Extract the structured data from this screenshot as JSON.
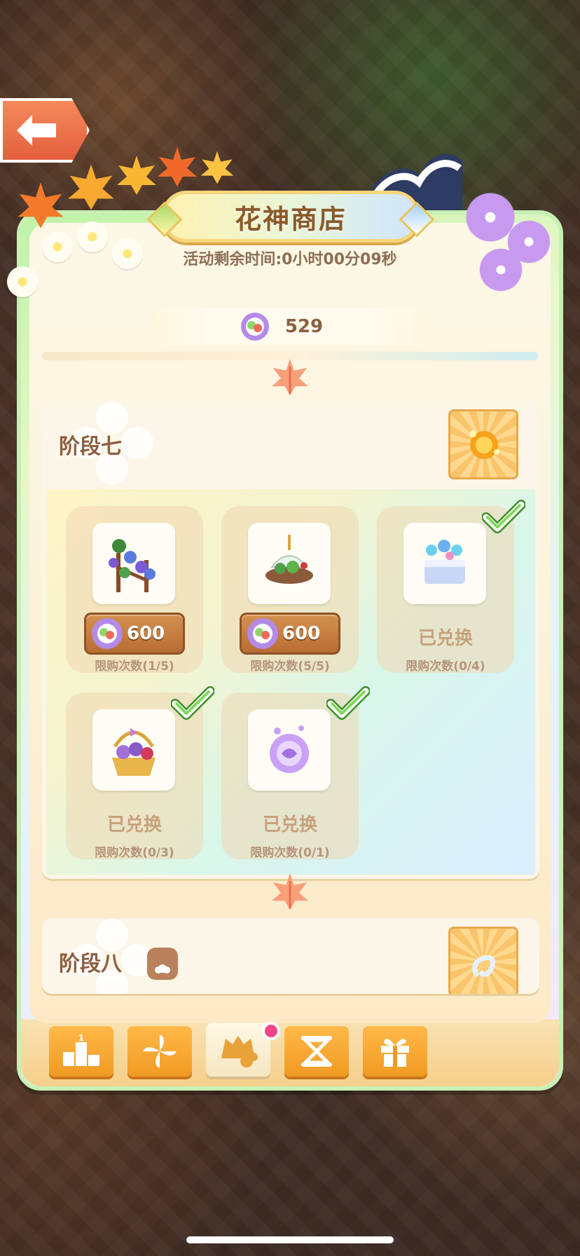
{
  "shop": {
    "title": "花神商店",
    "timer": "活动剩余时间:0小时00分09秒",
    "currency_value": "529"
  },
  "stages": [
    {
      "title": "阶段七",
      "locked": false,
      "items": [
        {
          "name": "morning glory vine",
          "price": "600",
          "status": "",
          "limit": "限购次数(1/5)",
          "redeemed": false
        },
        {
          "name": "plant dome lamp",
          "price": "600",
          "status": "",
          "limit": "限购次数(5/5)",
          "redeemed": false
        },
        {
          "name": "fairy cake",
          "price": "",
          "status": "已兑换",
          "limit": "限购次数(0/4)",
          "redeemed": true
        },
        {
          "name": "flower basket",
          "price": "",
          "status": "已兑换",
          "limit": "限购次数(0/3)",
          "redeemed": true
        },
        {
          "name": "purple orb",
          "price": "",
          "status": "已兑换",
          "limit": "限购次数(0/1)",
          "redeemed": true
        }
      ]
    },
    {
      "title": "阶段八",
      "locked": true,
      "items": []
    }
  ],
  "tabs": [
    {
      "icon": "ranking-icon",
      "active": false
    },
    {
      "icon": "pinwheel-icon",
      "active": false
    },
    {
      "icon": "shop-icon",
      "active": true,
      "badge": true
    },
    {
      "icon": "hourglass-icon",
      "active": false
    },
    {
      "icon": "gift-icon",
      "active": false
    }
  ],
  "colors": {
    "accent_orange": "#f09a22",
    "price_button": "#b86d34",
    "title_text": "#8a5a2a",
    "badge_pink": "#f2448a",
    "check_green": "#7ed957"
  }
}
